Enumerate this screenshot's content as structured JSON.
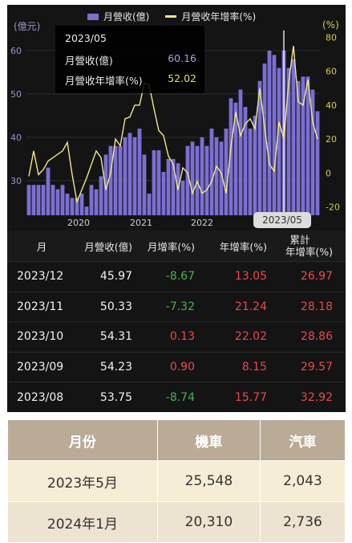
{
  "chart": {
    "unit_left": "(億元)",
    "unit_right": "(%)",
    "legend": {
      "revenue": "月營收(億)",
      "growth": "月營收年增率(%)"
    },
    "tooltip": {
      "date": "2023/05",
      "revenue_label": "月營收(億)",
      "revenue_value": "60.16",
      "growth_label": "月營收年增率(%)",
      "growth_value": "52.02"
    },
    "x_bubble": "2023/05",
    "colors": {
      "bar": "#7b6fd2",
      "line": "#f2e68c",
      "cursor": "#ffffff",
      "left_axis": "#9a94cc",
      "right_axis": "#d9c94c"
    }
  },
  "chart_data": {
    "type": "bar+line",
    "series": [
      {
        "name": "月營收(億)",
        "values": [
          29,
          29,
          29,
          29,
          33,
          29,
          28,
          29,
          27,
          26,
          26,
          27,
          24,
          29,
          28,
          31,
          36,
          38,
          38,
          38,
          40,
          41,
          40,
          42,
          36,
          27,
          37,
          37,
          32,
          35,
          35,
          34,
          30,
          38,
          39,
          38,
          40,
          38,
          42,
          40,
          39,
          42,
          49,
          48,
          51,
          47,
          42,
          45,
          53,
          57,
          60,
          59,
          56,
          60,
          56,
          58,
          53,
          54,
          54,
          51,
          46
        ]
      },
      {
        "name": "月營收年增率(%)",
        "values": [
          -2,
          13,
          -1,
          2,
          7,
          9,
          11,
          13,
          18,
          -1,
          -17,
          -10,
          -3,
          5,
          13,
          9,
          -10,
          0,
          20,
          16,
          32,
          33,
          40,
          40,
          53,
          52,
          38,
          25,
          22,
          10,
          5,
          -10,
          3,
          0,
          -12,
          -5,
          -12,
          -10,
          -5,
          4,
          0,
          -12,
          15,
          36,
          22,
          29,
          32,
          26,
          50,
          27,
          5,
          1,
          30,
          20,
          53,
          75,
          42,
          40,
          55,
          30,
          20
        ]
      }
    ],
    "x_ticks": [
      "2020",
      "2021",
      "2022",
      "2023/05"
    ],
    "y_left_ticks": [
      "30",
      "40",
      "50",
      "60"
    ],
    "y_right_ticks": [
      "-20",
      "0",
      "20",
      "40",
      "60",
      "80"
    ],
    "ylim_left": [
      22,
      65
    ],
    "ylim_right": [
      -25,
      85
    ]
  },
  "table": {
    "headers": [
      "月",
      "月營收(億)",
      "月增率(%)",
      "年增率(%)",
      "累計年增率(%)"
    ],
    "header_last_lines": [
      "累計",
      "年增率(%)"
    ],
    "rows": [
      {
        "month": "2023/12",
        "revenue": "45.97",
        "mom": "-8.67",
        "yoy": "13.05",
        "cum": "26.97",
        "mom_color": "green"
      },
      {
        "month": "2023/11",
        "revenue": "50.33",
        "mom": "-7.32",
        "yoy": "21.24",
        "cum": "28.18",
        "mom_color": "green"
      },
      {
        "month": "2023/10",
        "revenue": "54.31",
        "mom": "0.13",
        "yoy": "22.02",
        "cum": "28.86",
        "mom_color": "red"
      },
      {
        "month": "2023/09",
        "revenue": "54.23",
        "mom": "0.90",
        "yoy": "8.15",
        "cum": "29.57",
        "mom_color": "red"
      },
      {
        "month": "2023/08",
        "revenue": "53.75",
        "mom": "-8.74",
        "yoy": "15.77",
        "cum": "32.92",
        "mom_color": "green"
      }
    ]
  },
  "bottom_table": {
    "headers": [
      "月份",
      "機車",
      "汽車"
    ],
    "rows": [
      [
        "2023年5月",
        "25,548",
        "2,043"
      ],
      [
        "2024年1月",
        "20,310",
        "2,736"
      ]
    ]
  }
}
